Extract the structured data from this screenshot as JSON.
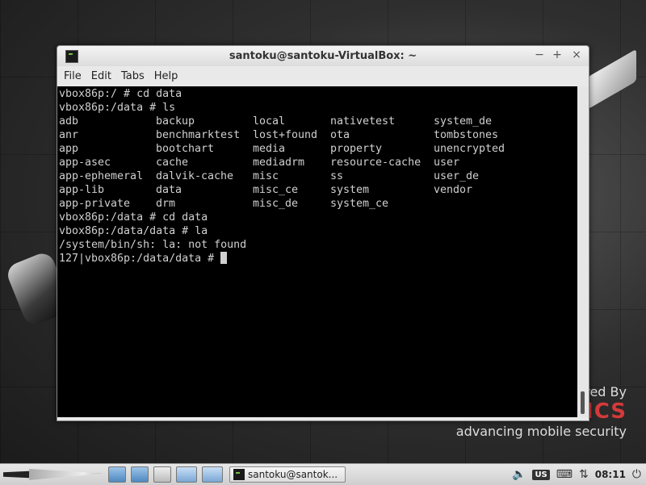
{
  "window": {
    "title": "santoku@santoku-VirtualBox: ~",
    "controls": {
      "minimize": "−",
      "maximize": "+",
      "close": "×"
    }
  },
  "menu": [
    "File",
    "Edit",
    "Tabs",
    "Help"
  ],
  "terminal": {
    "lines_before": [
      "vbox86p:/ # cd data",
      "vbox86p:/data # ls"
    ],
    "ls_rows": [
      [
        "adb",
        "backup",
        "local",
        "nativetest",
        "system_de"
      ],
      [
        "anr",
        "benchmarktest",
        "lost+found",
        "ota",
        "tombstones"
      ],
      [
        "app",
        "bootchart",
        "media",
        "property",
        "unencrypted"
      ],
      [
        "app-asec",
        "cache",
        "mediadrm",
        "resource-cache",
        "user"
      ],
      [
        "app-ephemeral",
        "dalvik-cache",
        "misc",
        "ss",
        "user_de"
      ],
      [
        "app-lib",
        "data",
        "misc_ce",
        "system",
        "vendor"
      ],
      [
        "app-private",
        "drm",
        "misc_de",
        "system_ce",
        ""
      ]
    ],
    "lines_after": [
      "vbox86p:/data # cd data",
      "vbox86p:/data/data # la",
      "/system/bin/sh: la: not found"
    ],
    "prompt": "127|vbox86p:/data/data # "
  },
  "desktop": {
    "brand_by": "red By",
    "brand_name": "VIAFORENSICS",
    "brand_tagline": "advancing mobile security"
  },
  "taskbar": {
    "task_label": "santoku@santok...",
    "keyboard_layout": "US",
    "clock": "08:11"
  }
}
